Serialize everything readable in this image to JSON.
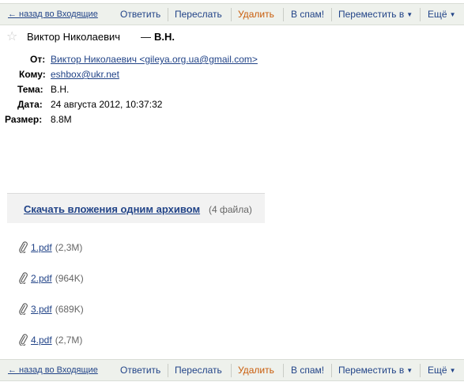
{
  "toolbar": {
    "back": "← назад во Входящие",
    "reply": "Ответить",
    "forward": "Переслать",
    "delete": "Удалить",
    "spam": "В спам!",
    "move": "Переместить в",
    "more": "Ещё"
  },
  "message": {
    "sender_name": "Виктор Николаевич",
    "subject": "В.Н.",
    "headers": {
      "from_label": "От:",
      "from_value": "Виктор Николаевич <gileya.org.ua@gmail.com>",
      "to_label": "Кому:",
      "to_value": "eshbox@ukr.net",
      "subject_label": "Тема:",
      "subject_value": "В.Н.",
      "date_label": "Дата:",
      "date_value": "24 августа 2012, 10:37:32",
      "size_label": "Размер:",
      "size_value": "8.8M"
    }
  },
  "archive": {
    "link": "Скачать вложения одним архивом",
    "count": "(4 файла)"
  },
  "attachments": [
    {
      "name": "1.pdf",
      "size": "(2,3M)"
    },
    {
      "name": "2.pdf",
      "size": "(964K)"
    },
    {
      "name": "3.pdf",
      "size": "(689K)"
    },
    {
      "name": "4.pdf",
      "size": "(2,7M)"
    }
  ],
  "colors": {
    "link": "#224488",
    "delete": "#c95c0a",
    "toolbar_bg": "#eef1ec"
  }
}
